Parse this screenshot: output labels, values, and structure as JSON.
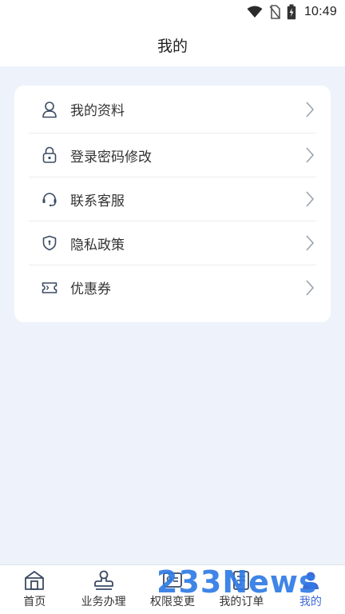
{
  "status_bar": {
    "time": "10:49",
    "icons": [
      "wifi-icon",
      "no-sim-icon",
      "battery-charging-icon"
    ]
  },
  "header": {
    "title": "我的"
  },
  "menu": {
    "items": [
      {
        "label": "我的资料",
        "icon": "user-icon"
      },
      {
        "label": "登录密码修改",
        "icon": "lock-icon"
      },
      {
        "label": "联系客服",
        "icon": "headset-icon"
      },
      {
        "label": "隐私政策",
        "icon": "shield-icon"
      },
      {
        "label": "优惠券",
        "icon": "ticket-icon"
      }
    ]
  },
  "tabbar": {
    "items": [
      {
        "label": "首页",
        "icon": "home-icon",
        "active": false
      },
      {
        "label": "业务办理",
        "icon": "stamp-icon",
        "active": false
      },
      {
        "label": "权限变更",
        "icon": "id-card-icon",
        "active": false
      },
      {
        "label": "我的订单",
        "icon": "order-list-icon",
        "active": false
      },
      {
        "label": "我的",
        "icon": "profile-icon",
        "active": true
      }
    ]
  },
  "watermark": {
    "text": "233News"
  },
  "colors": {
    "accent": "#3f6ad8",
    "background": "#eef3fb",
    "icon_stroke": "#3a4a63"
  }
}
